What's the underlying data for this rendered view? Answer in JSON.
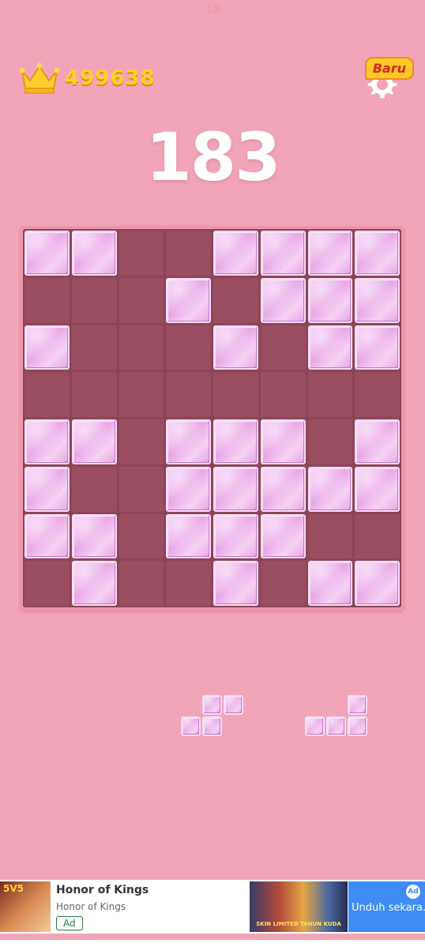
{
  "top_faint": "10",
  "best_score": "499638",
  "settings": {
    "badge": "Baru"
  },
  "score": "183",
  "board": {
    "rows": [
      [
        1,
        1,
        0,
        0,
        1,
        1,
        1,
        1
      ],
      [
        0,
        0,
        0,
        1,
        0,
        1,
        1,
        1
      ],
      [
        1,
        0,
        0,
        0,
        1,
        0,
        1,
        1
      ],
      [
        0,
        0,
        0,
        0,
        0,
        0,
        0,
        0
      ],
      [
        1,
        1,
        0,
        1,
        1,
        1,
        0,
        1
      ],
      [
        1,
        0,
        0,
        1,
        1,
        1,
        1,
        1
      ],
      [
        1,
        1,
        0,
        1,
        1,
        1,
        0,
        0
      ],
      [
        0,
        1,
        0,
        0,
        1,
        0,
        1,
        1
      ]
    ]
  },
  "pieces": [
    {
      "name": "s-piece",
      "cells": [
        [
          1,
          0
        ],
        [
          2,
          0
        ],
        [
          0,
          1
        ],
        [
          1,
          1
        ]
      ]
    },
    {
      "name": "l-piece",
      "cells": [
        [
          2,
          0
        ],
        [
          0,
          1
        ],
        [
          1,
          1
        ],
        [
          2,
          1
        ]
      ]
    }
  ],
  "ad": {
    "icon_text": "5V5",
    "title": "Honor of Kings",
    "subtitle": "Honor of Kings",
    "badge": "Ad",
    "banner_text": "SKIN LIMITED TAHUN KUDA",
    "cta": "Unduh sekara...",
    "cta_icon": "Ad"
  },
  "colors": {
    "background": "#f2a5b8",
    "board_empty": "#9a4d61",
    "block": "#ecaeea",
    "gold": "#ffcf2a",
    "cta": "#3f8cf6"
  }
}
